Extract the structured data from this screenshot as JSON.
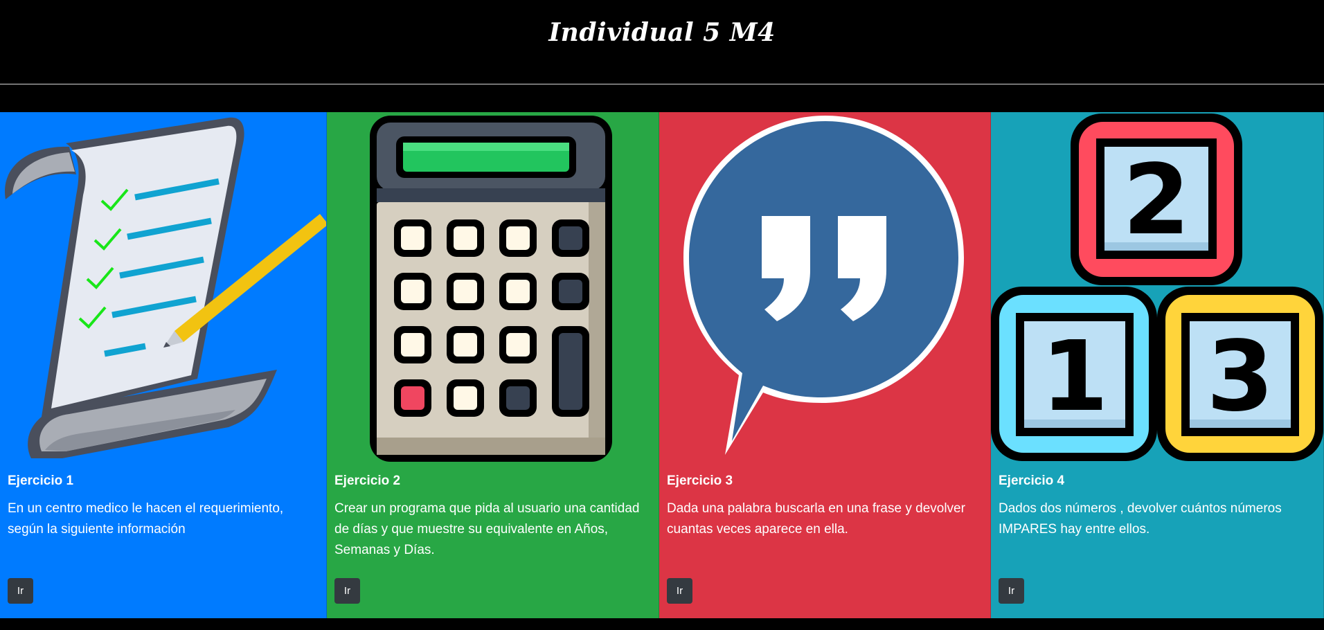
{
  "header": {
    "title": "Individual 5 M4"
  },
  "cards": [
    {
      "title": "Ejercicio 1",
      "text": "En un centro medico le hacen el requerimiento, según la siguiente información",
      "button": "Ir",
      "bg": "#007bff",
      "icon": "checklist-scroll-icon"
    },
    {
      "title": "Ejercicio 2",
      "text": "Crear un programa que pida al usuario una cantidad de días y que muestre su equivalente en Años, Semanas y Días.",
      "button": "Ir",
      "bg": "#28a745",
      "icon": "calculator-icon"
    },
    {
      "title": "Ejercicio 3",
      "text": "Dada una palabra buscarla en una frase y devolver cuantas veces aparece en ella.",
      "button": "Ir",
      "bg": "#dc3545",
      "icon": "quote-bubble-icon"
    },
    {
      "title": "Ejercicio 4",
      "text": "Dados dos números , devolver cuántos números IMPARES hay entre ellos.",
      "button": "Ir",
      "bg": "#17a2b8",
      "icon": "number-blocks-icon",
      "block_numbers": [
        "2",
        "1",
        "3"
      ]
    }
  ]
}
